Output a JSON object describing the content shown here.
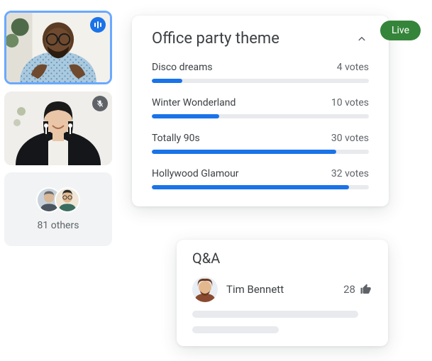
{
  "live_pill": "Live",
  "participants": {
    "tile0": {
      "state": "speaking"
    },
    "tile1": {
      "state": "muted"
    },
    "others_label": "81 others"
  },
  "poll": {
    "title": "Office party theme",
    "rows": [
      {
        "label": "Disco dreams",
        "votes_text": "4 votes",
        "pct": 14
      },
      {
        "label": "Winter Wonderland",
        "votes_text": "10 votes",
        "pct": 31
      },
      {
        "label": "Totally 90s",
        "votes_text": "30 votes",
        "pct": 85
      },
      {
        "label": "Hollywood Glamour",
        "votes_text": "32 votes",
        "pct": 91
      }
    ]
  },
  "qa": {
    "title": "Q&A",
    "name": "Tim Bennett",
    "upvotes": "28"
  }
}
